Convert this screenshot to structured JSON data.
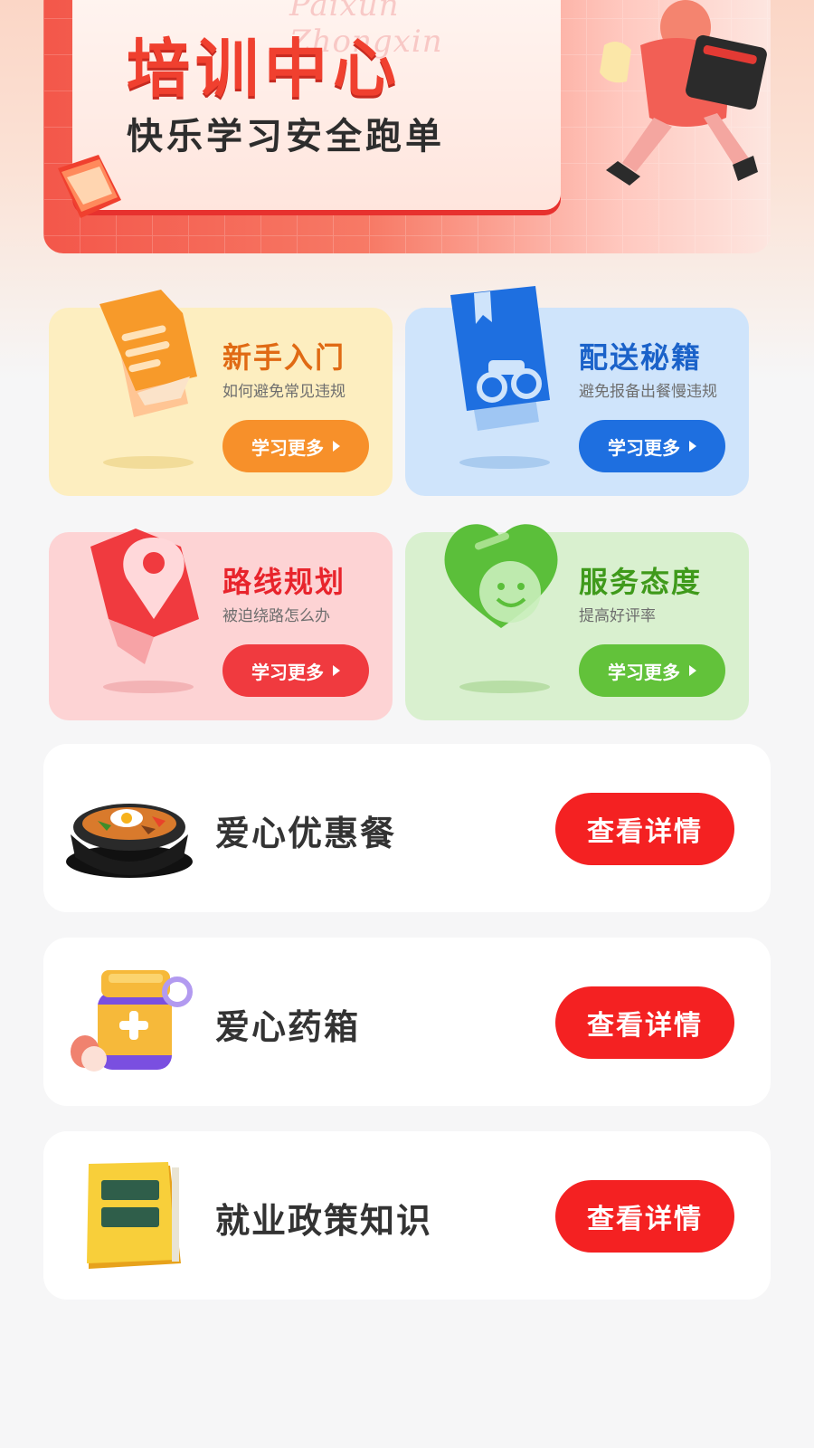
{
  "banner": {
    "title": "培训中心",
    "subtitle": "快乐学习安全跑单",
    "watermark": "Paixun Zhongxin"
  },
  "categories": [
    {
      "title": "新手入门",
      "desc": "如何避免常见违规",
      "button": "学习更多",
      "icon": "document-icon",
      "title_color": "#e06a14",
      "bg": "#fdeec0",
      "button_color": "#f7902a"
    },
    {
      "title": "配送秘籍",
      "desc": "避免报备出餐慢违规",
      "button": "学习更多",
      "icon": "delivery-book-icon",
      "title_color": "#1b62c9",
      "bg": "#cfe4fb",
      "button_color": "#1e6fe0"
    },
    {
      "title": "路线规划",
      "desc": "被迫绕路怎么办",
      "button": "学习更多",
      "icon": "map-pin-icon",
      "title_color": "#e8242c",
      "bg": "#fdd3d4",
      "button_color": "#f03a3f"
    },
    {
      "title": "服务态度",
      "desc": "提高好评率",
      "button": "学习更多",
      "icon": "heart-smile-icon",
      "title_color": "#3f9a1b",
      "bg": "#d9f0cf",
      "button_color": "#62c23a"
    }
  ],
  "list": [
    {
      "title": "爱心优惠餐",
      "button": "查看详情",
      "icon": "bibimbap-bowl-icon"
    },
    {
      "title": "爱心药箱",
      "button": "查看详情",
      "icon": "medicine-bottle-icon"
    },
    {
      "title": "就业政策知识",
      "button": "查看详情",
      "icon": "yellow-book-icon"
    }
  ]
}
